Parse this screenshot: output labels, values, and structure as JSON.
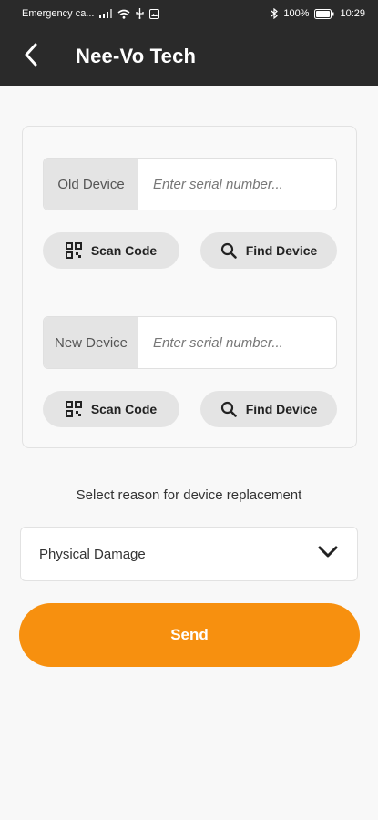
{
  "status_bar": {
    "carrier": "Emergency ca...",
    "battery": "100%",
    "time": "10:29"
  },
  "app_bar": {
    "title": "Nee-Vo Tech",
    "back_icon": "chevron-left-icon"
  },
  "old_device": {
    "label": "Old Device",
    "placeholder": "Enter serial number...",
    "value": "",
    "scan_label": "Scan Code",
    "find_label": "Find Device"
  },
  "new_device": {
    "label": "New Device",
    "placeholder": "Enter serial number...",
    "value": "",
    "scan_label": "Scan Code",
    "find_label": "Find Device"
  },
  "reason": {
    "prompt": "Select reason for device replacement",
    "selected": "Physical Damage"
  },
  "send_label": "Send",
  "colors": {
    "app_bar": "#2a2a2a",
    "accent": "#f7900f",
    "pill": "#e4e4e4"
  }
}
